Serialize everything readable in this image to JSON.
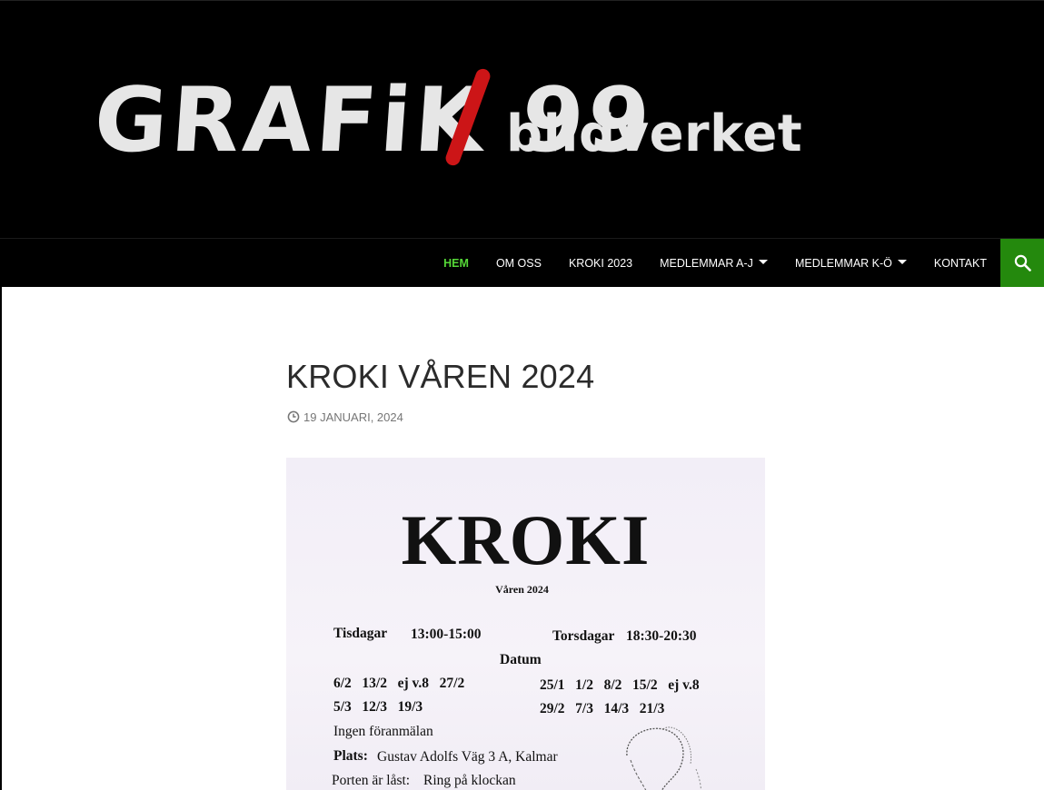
{
  "site": {
    "logo_text_main": "GRAFiK 99",
    "logo_text_sub": "bildverket"
  },
  "nav": {
    "items": [
      {
        "label": "HEM",
        "active": true,
        "dropdown": false
      },
      {
        "label": "OM OSS",
        "active": false,
        "dropdown": false
      },
      {
        "label": "KROKI 2023",
        "active": false,
        "dropdown": false
      },
      {
        "label": "MEDLEMMAR A-J",
        "active": false,
        "dropdown": true
      },
      {
        "label": "MEDLEMMAR K-Ö",
        "active": false,
        "dropdown": true
      },
      {
        "label": "KONTAKT",
        "active": false,
        "dropdown": false
      }
    ],
    "search_icon": "search-icon",
    "active_color": "#55d737",
    "search_bg": "#24890d"
  },
  "post": {
    "title": "KROKI VÅREN 2024",
    "date": "19 JANUARI, 2024",
    "date_icon": "clock-icon"
  },
  "poster": {
    "title": "KROKI",
    "subtitle": "Våren 2024",
    "tuesday_label": "Tisdagar",
    "tuesday_time": "13:00-15:00",
    "thursday_label": "Torsdagar",
    "thursday_time": "18:30-20:30",
    "dates_heading": "Datum",
    "tue_dates_1": "6/2   13/2   ej v.8   27/2",
    "tue_dates_2": "5/3   12/3   19/3",
    "thu_dates_1": "25/1   1/2   8/2   15/2   ej v.8",
    "thu_dates_2": "29/2   7/3   14/3   21/3",
    "no_registration": "Ingen föranmälan",
    "place_label": "Plats:",
    "place_value": "Gustav Adolfs Väg 3 A, Kalmar",
    "door_label": "Porten är låst:",
    "door_value": "Ring på klockan"
  }
}
